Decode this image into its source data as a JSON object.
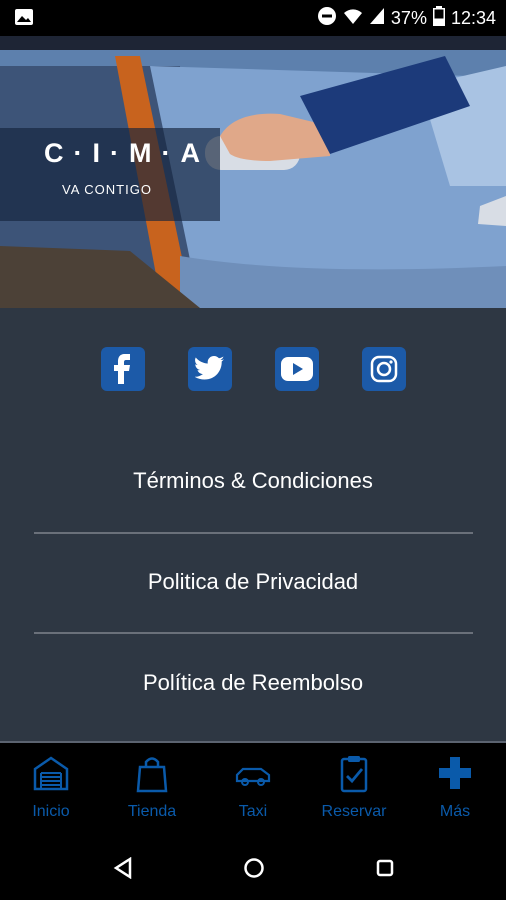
{
  "status_bar": {
    "battery_percent": "37%",
    "time": "12:34",
    "icons": [
      "image-icon",
      "do-not-disturb-icon",
      "wifi-icon",
      "signal-icon",
      "battery-icon"
    ]
  },
  "hero": {
    "logo_title": "C·I·M·A",
    "logo_subtitle": "VA CONTIGO"
  },
  "social": {
    "items": [
      "facebook-icon",
      "twitter-icon",
      "youtube-icon",
      "instagram-icon"
    ],
    "brand_color": "#1c5aa8"
  },
  "links": {
    "terms": "Términos & Condiciones",
    "privacy": "Politica de Privacidad",
    "refund": "Política de Reembolso"
  },
  "tabs": {
    "inicio": "Inicio",
    "tienda": "Tienda",
    "taxi": "Taxi",
    "reservar": "Reservar",
    "mas": "Más",
    "accent": "#0a5aaa"
  },
  "panel_bg": "#2e3743"
}
